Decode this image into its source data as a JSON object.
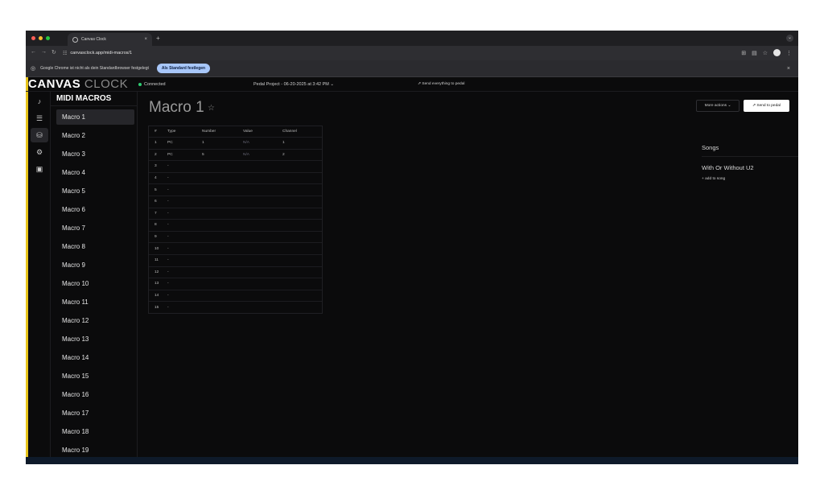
{
  "browser": {
    "tab_title": "Canvas Clock",
    "new_tab": "+",
    "tab_close": "×",
    "url": "canvasclock.app/midi-macros/1",
    "infobar_text": "Google Chrome ist nicht als dein Standardbrowser festgelegt",
    "infobar_button": "Als Standard festlegen",
    "infobar_close": "×",
    "traffic_colors": [
      "#ff5f57",
      "#febc2e",
      "#28c840"
    ]
  },
  "app": {
    "logo_bold": "CANVAS",
    "logo_light": "CLOCK",
    "status": "Connected",
    "project": "Pedal Project - 06-20-2025 at 3:42 PM ⌄",
    "send_all": "Send everything to pedal",
    "rail_icons": [
      "music-note-icon",
      "list-icon",
      "stack-icon",
      "gear-icon",
      "pedal-icon"
    ]
  },
  "sidebar": {
    "title": "MIDI MACROS",
    "items": [
      "Macro 1",
      "Macro 2",
      "Macro 3",
      "Macro 4",
      "Macro 5",
      "Macro 6",
      "Macro 7",
      "Macro 8",
      "Macro 9",
      "Macro 10",
      "Macro 11",
      "Macro 12",
      "Macro 13",
      "Macro 14",
      "Macro 15",
      "Macro 16",
      "Macro 17",
      "Macro 18",
      "Macro 19"
    ],
    "active_index": 0
  },
  "main": {
    "title": "Macro 1",
    "more_actions": "More actions ⌄",
    "send_to_pedal": "Send to pedal",
    "table": {
      "headers": [
        "#",
        "Type",
        "Number",
        "Value",
        "Channel"
      ],
      "rows": [
        [
          "1",
          "PC",
          "1",
          "N/A",
          "1"
        ],
        [
          "2",
          "PC",
          "5",
          "N/A",
          "2"
        ],
        [
          "3",
          "-",
          "",
          "",
          ""
        ],
        [
          "4",
          "-",
          "",
          "",
          ""
        ],
        [
          "5",
          "-",
          "",
          "",
          ""
        ],
        [
          "6",
          "-",
          "",
          "",
          ""
        ],
        [
          "7",
          "-",
          "",
          "",
          ""
        ],
        [
          "8",
          "-",
          "",
          "",
          ""
        ],
        [
          "9",
          "-",
          "",
          "",
          ""
        ],
        [
          "10",
          "-",
          "",
          "",
          ""
        ],
        [
          "11",
          "-",
          "",
          "",
          ""
        ],
        [
          "12",
          "-",
          "",
          "",
          ""
        ],
        [
          "13",
          "-",
          "",
          "",
          ""
        ],
        [
          "14",
          "-",
          "",
          "",
          ""
        ],
        [
          "15",
          "-",
          "",
          "",
          ""
        ]
      ]
    }
  },
  "songs": {
    "title": "Songs",
    "items": [
      "With Or Without U2"
    ],
    "add_label": "+ add to song"
  },
  "colors": {
    "accent_yellow": "#e8c51c",
    "connected_green": "#2ecc71",
    "info_button": "#a8c7fa"
  }
}
